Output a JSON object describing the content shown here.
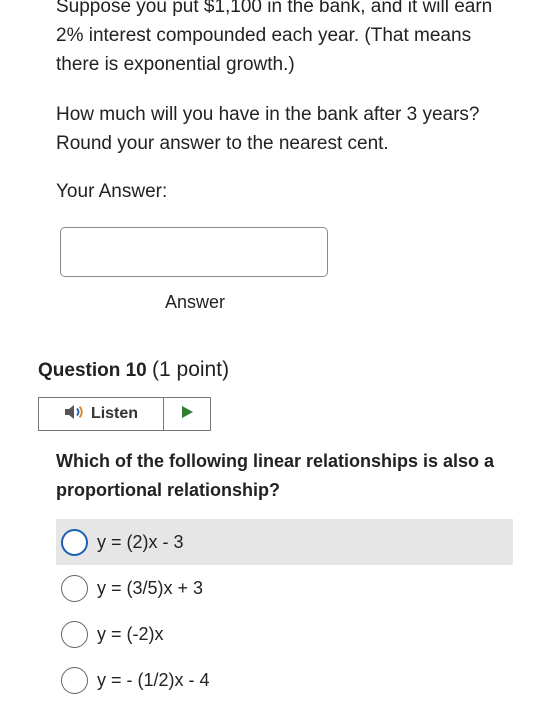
{
  "question9": {
    "paragraph1": "Suppose you put $1,100 in the bank, and it will earn 2% interest compounded each year. (That means there is exponential growth.)",
    "paragraph2": "How much will you have in the bank after 3 years? Round your answer to the nearest cent.",
    "answer_label": "Your Answer:",
    "answer_value": "",
    "answer_caption": "Answer"
  },
  "question10": {
    "heading_num": "Question 10",
    "heading_points": "(1 point)",
    "listen_label": "Listen",
    "prompt": "Which of the following linear relationships is also a proportional relationship?",
    "options": [
      {
        "label": "y = (2)x - 3",
        "selected": false,
        "highlighted": true
      },
      {
        "label": "y = (3/5)x + 3",
        "selected": false,
        "highlighted": false
      },
      {
        "label": "y = (-2)x",
        "selected": false,
        "highlighted": false
      },
      {
        "label": "y = - (1/2)x - 4",
        "selected": false,
        "highlighted": false
      }
    ]
  },
  "colors": {
    "radio_focus": "#1a5fb4",
    "highlight_bg": "#e6e6e6",
    "play_icon": "#2e7d32",
    "speaker_icon": "#1a5fb4"
  },
  "icons": {
    "listen": "speaker-icon",
    "play": "play-icon"
  }
}
